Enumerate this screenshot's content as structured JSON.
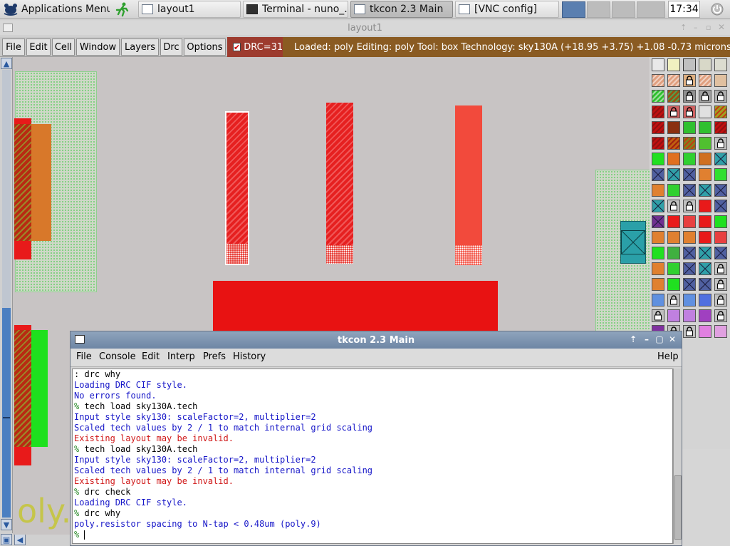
{
  "taskbar": {
    "apps_menu": "Applications Menu",
    "tasks": [
      {
        "label": "layout1",
        "icon": "window-icon"
      },
      {
        "label": "Terminal - nuno_...",
        "icon": "terminal-icon"
      },
      {
        "label": "tkcon 2.3 Main",
        "icon": "window-icon"
      },
      {
        "label": "[VNC config]",
        "icon": "window-icon"
      }
    ],
    "clock": "17:34"
  },
  "magic": {
    "window_title": "layout1",
    "menu": [
      "File",
      "Edit",
      "Cell",
      "Window",
      "Layers",
      "Drc",
      "Options"
    ],
    "drc_label": "DRC=31",
    "status": "Loaded: poly Editing: poly Tool: box  Technology: sky130A     (+18.95 +3.75) +1.08 -0.73 microns",
    "canvas_label": "oly."
  },
  "colors": {
    "accent_drc": "#9d3b2e",
    "status_bar": "#8a5b22",
    "poly_red": "#e52a22",
    "ndiff_green": "#1ee01e",
    "ntap_teal": "#2aa0a8",
    "nwell_dots": "#7fcf7f"
  },
  "tkcon": {
    "title": "tkcon 2.3 Main",
    "menu": [
      "File",
      "Console",
      "Edit",
      "Interp",
      "Prefs",
      "History"
    ],
    "help": "Help",
    "lines": [
      {
        "prompt": ":",
        "text": "drc why",
        "kind": "stdout"
      },
      {
        "prompt": "",
        "text": "Loading DRC CIF style.",
        "kind": "info"
      },
      {
        "prompt": "",
        "text": "No errors found.",
        "kind": "info"
      },
      {
        "prompt": "%",
        "text": "tech load sky130A.tech",
        "kind": "cmd"
      },
      {
        "prompt": "",
        "text": "Input style sky130: scaleFactor=2, multiplier=2",
        "kind": "info"
      },
      {
        "prompt": "",
        "text": "Scaled tech values by 2 / 1 to match internal grid scaling",
        "kind": "info"
      },
      {
        "prompt": "",
        "text": "Existing layout may be invalid.",
        "kind": "err"
      },
      {
        "prompt": "%",
        "text": "tech load sky130A.tech",
        "kind": "cmd"
      },
      {
        "prompt": "",
        "text": "Input style sky130: scaleFactor=2, multiplier=2",
        "kind": "info"
      },
      {
        "prompt": "",
        "text": "Scaled tech values by 2 / 1 to match internal grid scaling",
        "kind": "info"
      },
      {
        "prompt": "",
        "text": "Existing layout may be invalid.",
        "kind": "err"
      },
      {
        "prompt": "%",
        "text": "drc check",
        "kind": "cmd"
      },
      {
        "prompt": "",
        "text": "Loading DRC CIF style.",
        "kind": "info"
      },
      {
        "prompt": "%",
        "text": "drc why",
        "kind": "cmd"
      },
      {
        "prompt": "",
        "text": "poly.resistor spacing to N-tap < 0.48um (poly.9)",
        "kind": "info"
      },
      {
        "prompt": "%",
        "text": "",
        "kind": "cmd"
      }
    ]
  }
}
